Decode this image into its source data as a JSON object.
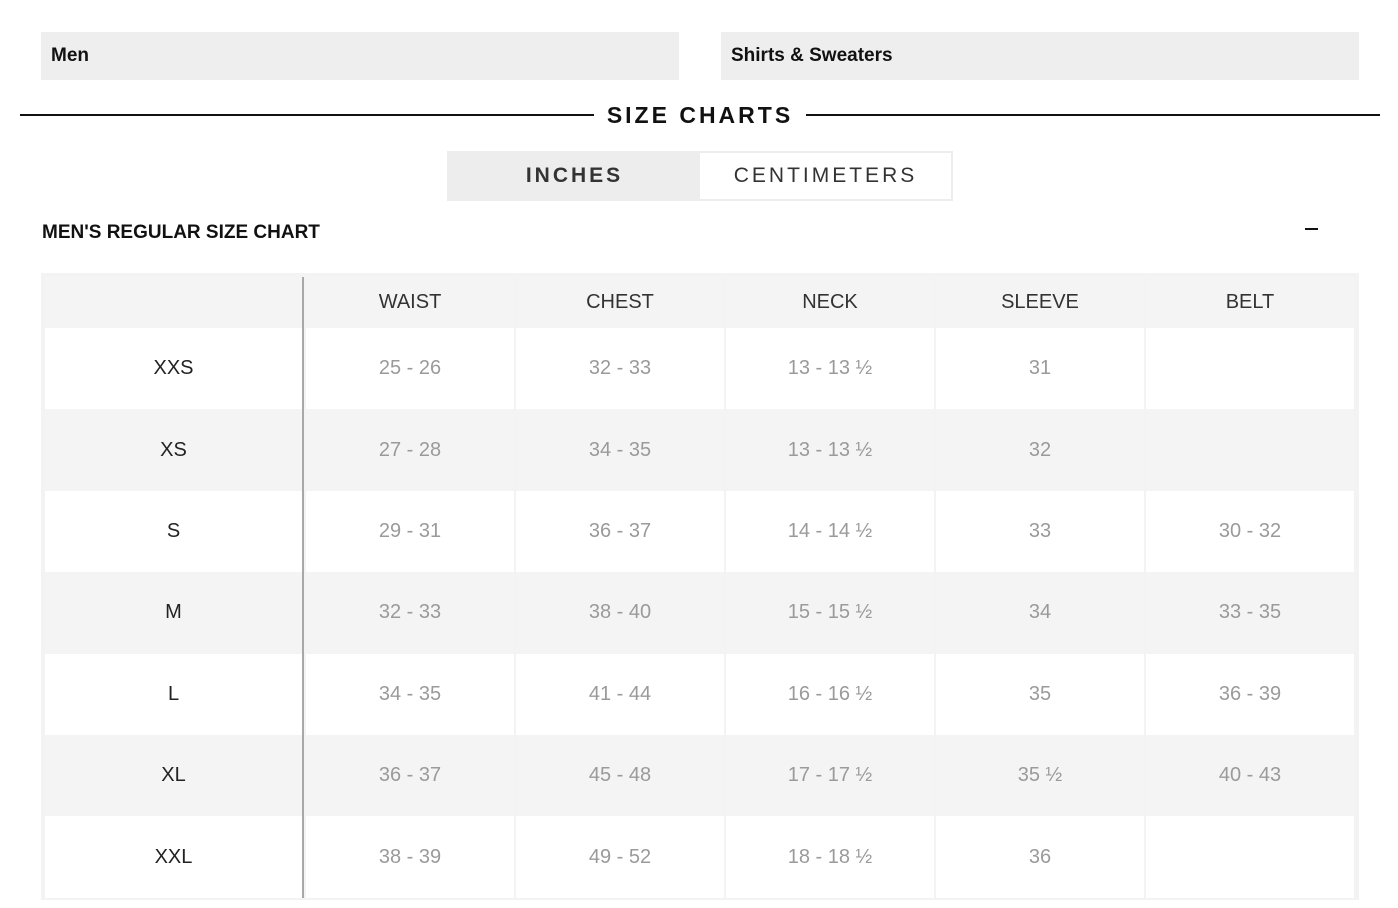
{
  "selectors": {
    "category": "Men",
    "subcategory": "Shirts & Sweaters"
  },
  "heading": "SIZE CHARTS",
  "unit_toggle": {
    "options": [
      "INCHES",
      "CENTIMETERS"
    ],
    "selected": "INCHES"
  },
  "section": {
    "title": "MEN'S REGULAR SIZE CHART",
    "collapse_icon": "minus-icon"
  },
  "size_chart": {
    "columns": [
      "",
      "WAIST",
      "CHEST",
      "NECK",
      "SLEEVE",
      "BELT"
    ],
    "rows": [
      {
        "size": "XXS",
        "waist": "25 - 26",
        "chest": "32 - 33",
        "neck": "13 - 13 ½",
        "sleeve": "31",
        "belt": ""
      },
      {
        "size": "XS",
        "waist": "27 - 28",
        "chest": "34 - 35",
        "neck": "13 - 13 ½",
        "sleeve": "32",
        "belt": ""
      },
      {
        "size": "S",
        "waist": "29 - 31",
        "chest": "36 - 37",
        "neck": "14 - 14 ½",
        "sleeve": "33",
        "belt": "30 - 32"
      },
      {
        "size": "M",
        "waist": "32 - 33",
        "chest": "38 - 40",
        "neck": "15 - 15 ½",
        "sleeve": "34",
        "belt": "33 - 35"
      },
      {
        "size": "L",
        "waist": "34 - 35",
        "chest": "41 - 44",
        "neck": "16 - 16 ½",
        "sleeve": "35",
        "belt": "36 - 39"
      },
      {
        "size": "XL",
        "waist": "36 - 37",
        "chest": "45 - 48",
        "neck": "17 - 17 ½",
        "sleeve": "35 ½",
        "belt": "40 - 43"
      },
      {
        "size": "XXL",
        "waist": "38 - 39",
        "chest": "49 - 52",
        "neck": "18 - 18 ½",
        "sleeve": "36",
        "belt": ""
      }
    ]
  }
}
